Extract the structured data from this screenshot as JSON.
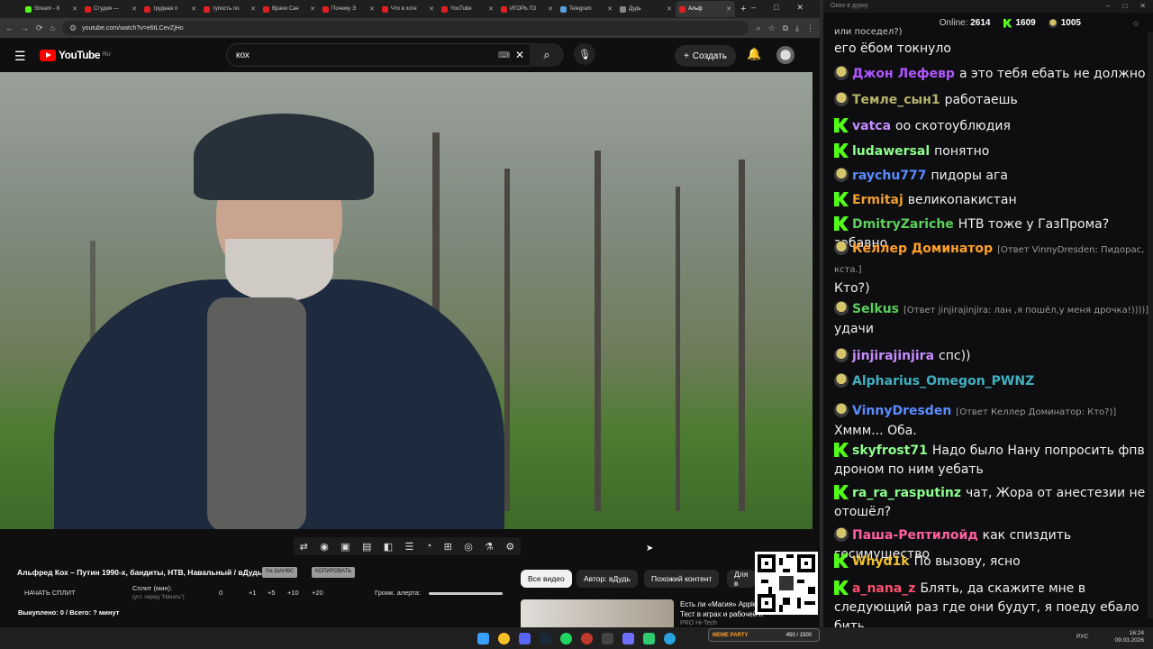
{
  "browser": {
    "tabs": [
      {
        "label": "Stream - K",
        "color": "#53fc18"
      },
      {
        "label": "Студия —",
        "color": "#e02020"
      },
      {
        "label": "трудная п",
        "color": "#e02020"
      },
      {
        "label": "тупость по",
        "color": "#e02020"
      },
      {
        "label": "Врачи Сан",
        "color": "#e02020"
      },
      {
        "label": "Почему Э",
        "color": "#e02020"
      },
      {
        "label": "Что в хоте",
        "color": "#e02020"
      },
      {
        "label": "YouTube",
        "color": "#e02020"
      },
      {
        "label": "ИГОРЬ ГО",
        "color": "#e02020"
      },
      {
        "label": "Telegram",
        "color": "#5aa0e0"
      },
      {
        "label": "Дудь",
        "color": "#888888"
      },
      {
        "label": "Альф",
        "color": "#e02020"
      }
    ],
    "new_tab": "+",
    "url": "youtube.com/watch?v=e6tLCevZjHo"
  },
  "youtube": {
    "logo_text": "YouTube",
    "logo_region": "RU",
    "search_value": "кох",
    "create_label": "Создать",
    "video_title": "Альфред Кох – Путин 1990-х, бандиты, НТВ, Навальный / вДудь",
    "pill_1": "На ШАНВС",
    "pill_2": "КОПИРОВАТЬ",
    "start_split": "НАЧАТЬ СПЛИТ",
    "split_label": "Сплит (мин):",
    "split_hint": "(уст. перед \"Начать\")",
    "split_values": [
      "0",
      "+1",
      "+5",
      "+10",
      "+20"
    ],
    "alert_volume": "Громк. алерта:",
    "bought": "Выкуплено: 0 / Всего: ? минут",
    "chips": [
      "Все видео",
      "Автор: вДудь",
      "Похожий контент",
      "Для в"
    ],
    "rec_title": "Есть ли «Магия» Apple",
    "rec_sub": "Тест в играх и рабочей п",
    "rec_channel": "PRO Hi-Tech"
  },
  "chat": {
    "window_title": "Окно в дурку",
    "online_label": "Online:",
    "online_value": "2614",
    "kick_count": "1609",
    "other_count": "1005",
    "top_partial": "или поседел?)",
    "top_text": "его ёбом токнуло",
    "messages": [
      {
        "badge": "p",
        "nick": "Джон Лефевр",
        "color": "#b057ff",
        "reply": "",
        "text": "а это тебя ебать не должно"
      },
      {
        "badge": "p",
        "nick": "Темле_сын1",
        "color": "#b7b26c",
        "reply": "",
        "text": "работаешь"
      },
      {
        "badge": "k",
        "nick": "vatca",
        "color": "#c58cff",
        "reply": "",
        "text": "оо скотоублюдия"
      },
      {
        "badge": "k",
        "nick": "ludawersal",
        "color": "#8cff8c",
        "reply": "",
        "text": "понятно"
      },
      {
        "badge": "p",
        "nick": "raychu777",
        "color": "#5a8cff",
        "reply": "",
        "text": "пидоры ага"
      },
      {
        "badge": "k",
        "nick": "Ermitaj",
        "color": "#f0a030",
        "reply": "",
        "text": "великопакистан"
      },
      {
        "badge": "k",
        "nick": "DmitryZariche",
        "color": "#5ccf5c",
        "reply": "",
        "text": "НТВ тоже у ГазПрома? забавно"
      },
      {
        "badge": "p",
        "nick": "Келлер Доминатор",
        "color": "#ff9f2a",
        "reply": "[Ответ VinnyDresden: Пидорас, кста.]",
        "text": "Кто?)"
      },
      {
        "badge": "p",
        "nick": "Selkus",
        "color": "#5ccf5c",
        "reply": "[Ответ jinjirajinjira: лан ,я пошёл,у меня дрочка!))))]",
        "text": "удачи"
      },
      {
        "badge": "p",
        "nick": "jinjirajinjira",
        "color": "#c58cff",
        "reply": "",
        "text": "спс))"
      },
      {
        "badge": "p",
        "nick": "Alpharius_Omegon_PWNZ",
        "color": "#40b0c0",
        "reply": "",
        "text": ""
      },
      {
        "badge": "p",
        "nick": "VinnyDresden",
        "color": "#5a8cff",
        "reply": "[Ответ Келлер Доминатор: Кто?)]",
        "text": "Хммм... Оба."
      },
      {
        "badge": "k",
        "nick": "skyfrost71",
        "color": "#8cff8c",
        "reply": "",
        "text": "Надо было Нану попросить фпв дроном по ним уебать"
      },
      {
        "badge": "k",
        "nick": "ra_ra_rasputinz",
        "color": "#8cff8c",
        "reply": "",
        "text": "чат, Жора от анестезии не отошёл?"
      },
      {
        "badge": "p",
        "nick": "Паша-Рептилойд",
        "color": "#ff5fa0",
        "reply": "",
        "text": "как спиздить госимущество"
      },
      {
        "badge": "k",
        "nick": "Whyd1k",
        "color": "#f0c030",
        "reply": "",
        "text": "По вызову, ясно"
      },
      {
        "badge": "k",
        "nick": "a_nana_z",
        "color": "#ff4f6f",
        "reply": "",
        "text": "Блять, да скажите мне в следующий раз где они будут, я поеду ебало бить"
      }
    ]
  },
  "overlay": {
    "meme_label": "MEME PARTY",
    "meme_counter": "450 / 1500"
  },
  "taskbar": {
    "lang": "РУС",
    "time": "16:24",
    "date": "09.03.2026"
  }
}
